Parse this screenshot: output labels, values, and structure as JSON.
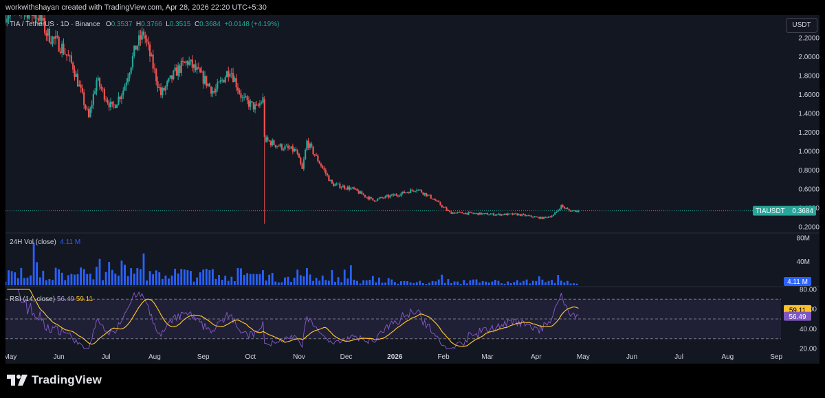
{
  "header": {
    "attribution": "workwithshayan created with TradingView.com, Apr 28, 2026 22:20 UTC+5:30"
  },
  "legend": {
    "symbol": "TIA / TetherUS · 1D · Binance",
    "o_label": "O",
    "o_value": "0.3537",
    "h_label": "H",
    "h_value": "0.3766",
    "l_label": "L",
    "l_value": "0.3515",
    "c_label": "C",
    "c_value": "0.3684",
    "change": "+0.0148 (+4.19%)"
  },
  "currency_button": "USDT",
  "price_tag": {
    "symbol": "TIAUSDT",
    "value": "0.3684"
  },
  "volume_legend": {
    "title": "24H Vol (close)",
    "value": "4.11 M"
  },
  "volume_tag": "4.11 M",
  "rsi_legend": {
    "title": "RSI (14, close)",
    "rsi": "56.49",
    "ma": "59.11"
  },
  "rsi_tags": {
    "ma": "59.11",
    "rsi": "56.49"
  },
  "branding": {
    "name": "TradingView"
  },
  "colors": {
    "up": "#26a69a",
    "down": "#ef5350",
    "volume": "#2962ff",
    "rsi": "#7e57c2",
    "rsi_ma": "#fbc02d",
    "background": "#131722"
  },
  "chart_data": [
    {
      "type": "candlestick",
      "pair": "TIA / TetherUS",
      "interval": "1D",
      "exchange": "Binance",
      "y_ticks": [
        "0.2000",
        "0.4000",
        "0.6000",
        "0.8000",
        "1.0000",
        "1.2000",
        "1.4000",
        "1.6000",
        "1.8000",
        "2.0000",
        "2.2000"
      ],
      "y_range": [
        0.14,
        2.44
      ],
      "x_ticks": [
        "May",
        "Jun",
        "Jul",
        "Aug",
        "Sep",
        "Oct",
        "Nov",
        "Dec",
        "2026",
        "Feb",
        "Mar",
        "Apr",
        "May",
        "Jun",
        "Jul",
        "Aug",
        "Sep"
      ],
      "last_price": 0.3684,
      "close_series": [
        {
          "date": "2025-04-28",
          "close": 2.45
        },
        {
          "date": "2025-05-10",
          "close": 2.5
        },
        {
          "date": "2025-05-20",
          "close": 2.42
        },
        {
          "date": "2025-05-24",
          "close": 2.25
        },
        {
          "date": "2025-06-03",
          "close": 2.1
        },
        {
          "date": "2025-06-10",
          "close": 1.9
        },
        {
          "date": "2025-06-20",
          "close": 1.35
        },
        {
          "date": "2025-06-25",
          "close": 1.75
        },
        {
          "date": "2025-07-05",
          "close": 1.45
        },
        {
          "date": "2025-07-12",
          "close": 1.65
        },
        {
          "date": "2025-07-20",
          "close": 2.1
        },
        {
          "date": "2025-07-25",
          "close": 2.25
        },
        {
          "date": "2025-08-05",
          "close": 1.6
        },
        {
          "date": "2025-08-15",
          "close": 1.85
        },
        {
          "date": "2025-08-22",
          "close": 1.95
        },
        {
          "date": "2025-09-02",
          "close": 1.75
        },
        {
          "date": "2025-09-08",
          "close": 1.62
        },
        {
          "date": "2025-09-18",
          "close": 1.88
        },
        {
          "date": "2025-09-26",
          "close": 1.55
        },
        {
          "date": "2025-10-05",
          "close": 1.45
        },
        {
          "date": "2025-10-09",
          "close": 1.55
        },
        {
          "date": "2025-10-10",
          "close": 1.12
        },
        {
          "date": "2025-10-20",
          "close": 1.05
        },
        {
          "date": "2025-10-30",
          "close": 1.0
        },
        {
          "date": "2025-11-03",
          "close": 0.8
        },
        {
          "date": "2025-11-06",
          "close": 1.1
        },
        {
          "date": "2025-11-15",
          "close": 0.85
        },
        {
          "date": "2025-11-22",
          "close": 0.65
        },
        {
          "date": "2025-12-05",
          "close": 0.6
        },
        {
          "date": "2025-12-18",
          "close": 0.48
        },
        {
          "date": "2026-01-05",
          "close": 0.55
        },
        {
          "date": "2026-01-15",
          "close": 0.6
        },
        {
          "date": "2026-01-25",
          "close": 0.5
        },
        {
          "date": "2026-02-05",
          "close": 0.35
        },
        {
          "date": "2026-02-20",
          "close": 0.34
        },
        {
          "date": "2026-03-05",
          "close": 0.33
        },
        {
          "date": "2026-03-20",
          "close": 0.33
        },
        {
          "date": "2026-04-05",
          "close": 0.29
        },
        {
          "date": "2026-04-12",
          "close": 0.32
        },
        {
          "date": "2026-04-17",
          "close": 0.42
        },
        {
          "date": "2026-04-22",
          "close": 0.37
        },
        {
          "date": "2026-04-28",
          "close": 0.3684
        }
      ]
    },
    {
      "type": "bar",
      "title": "24H Vol (close)",
      "y_ticks": [
        "40M",
        "80M"
      ],
      "y_range": [
        0,
        80
      ],
      "last_value": "4.11 M"
    },
    {
      "type": "line",
      "title": "RSI (14, close)",
      "y_ticks": [
        "20.00",
        "40.00",
        "60.00",
        "80.00"
      ],
      "y_range": [
        18,
        82
      ],
      "bands": [
        30,
        50,
        70
      ],
      "series": [
        {
          "name": "RSI",
          "last": 56.49
        },
        {
          "name": "MA",
          "last": 59.11
        }
      ]
    }
  ]
}
